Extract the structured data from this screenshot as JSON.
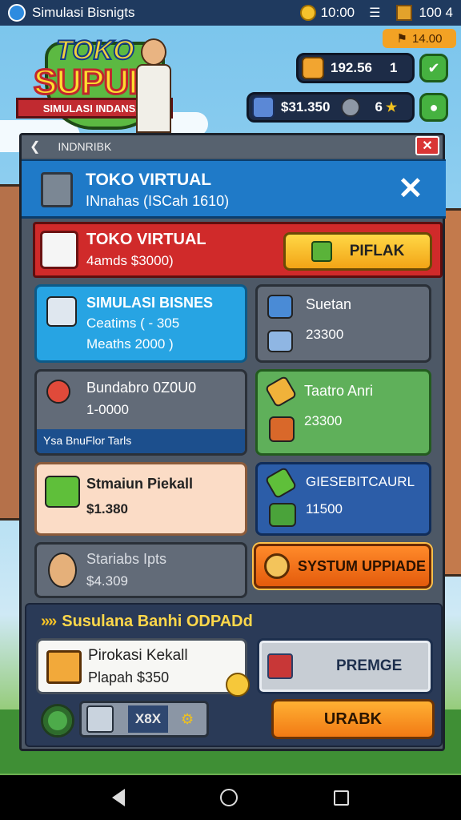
{
  "status_bar": {
    "app_title": "Simulasi Bisnigts",
    "time": "10:00",
    "right_value": "100 4"
  },
  "resources": {
    "bonus_label": "14.00",
    "bar1_value": "192.56",
    "bar1_suffix": "1",
    "bar2_money": "$31.350",
    "bar2_count": "6"
  },
  "logo": {
    "top": "TOKO",
    "main": "SUPUIR",
    "ribbon": "SIMULASI INDANSAI"
  },
  "panel": {
    "header": "INDNRIBK",
    "store": {
      "title": "TOKO VIRTUAL",
      "subtitle": "INnahas (ISCah 1610)"
    },
    "offer_main": {
      "title": "TOKO VIRTUAL",
      "subtitle": "4amds $3000)",
      "button": "PIFLAK"
    },
    "cards": [
      {
        "title": "SIMULASI BISNES",
        "line1": "Ceatims ( - 305",
        "line2": "Meaths 2000    )"
      },
      {
        "title": "Suetan",
        "value": "23300"
      },
      {
        "title": "Bundabro 0Z0U0",
        "value": "1-0000",
        "strip": "Ysa BnuFlor Tarls"
      },
      {
        "title": "Taatro Anri",
        "value": "23300"
      },
      {
        "title": "Stmaiun Piekall",
        "value": "$1.380"
      },
      {
        "title": "GIESEBITCAURL",
        "value": "11500"
      },
      {
        "title": "Stariabs Ipts",
        "value": "$4.309"
      }
    ],
    "upgrade_button": "SYSTUM UPPIADE",
    "bottom": {
      "title": "Susulana Banhi ODPADd",
      "offer_title": "Pirokasi Kekall",
      "offer_price": "Plapah $350",
      "premium_button": "PREMGE",
      "counter_value": "X8X",
      "action_button": "URABK"
    }
  }
}
